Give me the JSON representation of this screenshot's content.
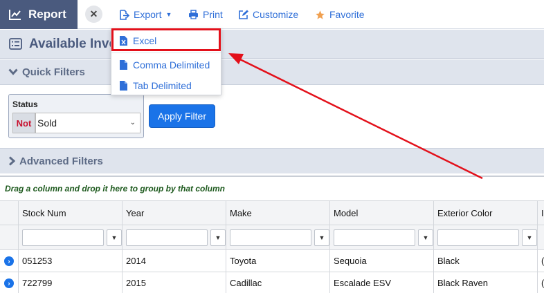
{
  "toolbar": {
    "report_label": "Report",
    "close_symbol": "✕",
    "export_label": "Export",
    "print_label": "Print",
    "customize_label": "Customize",
    "favorite_label": "Favorite"
  },
  "page": {
    "title": "Available Inve"
  },
  "quick_filters": {
    "header": "Quick Filters",
    "status_label": "Status",
    "not_label": "Not",
    "status_value": "Sold",
    "apply_label": "Apply Filter"
  },
  "advanced_filters": {
    "header": "Advanced Filters"
  },
  "group_panel": {
    "text": "Drag a column and drop it here to group by that column"
  },
  "grid": {
    "columns": [
      "Stock Num",
      "Year",
      "Make",
      "Model",
      "Exterior Color",
      "I"
    ],
    "rows": [
      [
        "051253",
        "2014",
        "Toyota",
        "Sequoia",
        "Black",
        "("
      ],
      [
        "722799",
        "2015",
        "Cadillac",
        "Escalade ESV",
        "Black Raven",
        "("
      ]
    ]
  },
  "export_menu": {
    "items": [
      "Excel",
      "Comma Delimited",
      "Tab Delimited"
    ]
  },
  "icons": {
    "report": "line-chart-icon",
    "export": "export-icon",
    "print": "print-icon",
    "customize": "edit-icon",
    "favorite": "star-icon",
    "file": "file-icon",
    "excel": "excel-file-icon"
  },
  "colors": {
    "report_tab_bg": "#4a5a7e",
    "accent_blue": "#2f6fd8",
    "apply_button": "#1a73e8",
    "annotation_red": "#e3101a",
    "favorite_star": "#f0a050",
    "not_red": "#c8102e",
    "group_text_green": "#1e5a1e"
  }
}
